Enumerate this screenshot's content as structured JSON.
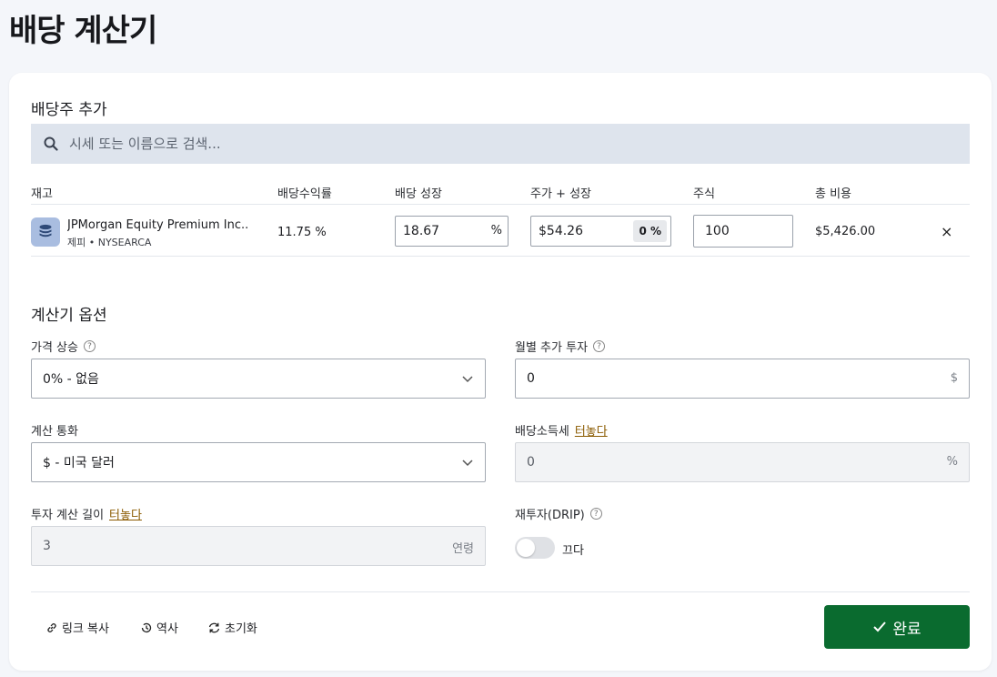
{
  "page": {
    "title": "배당 계산기"
  },
  "add_section": {
    "title": "배당주 추가",
    "search_placeholder": "시세 또는 이름으로 검색..."
  },
  "table": {
    "headers": [
      "재고",
      "배당수익률",
      "배당 성장",
      "주가 + 성장",
      "주식",
      "총 비용"
    ],
    "rows": [
      {
        "name": "JPMorgan Equity Premium Inc...",
        "sub": "제피 • NYSEARCA",
        "yield": "11.75 %",
        "growth": "18.67",
        "growth_unit": "%",
        "price": "$54.26",
        "price_growth": "0 %",
        "shares": "100",
        "total_cost": "$5,426.00",
        "remove_glyph": "×"
      }
    ]
  },
  "options": {
    "title": "계산기 옵션",
    "price_increase": {
      "label": "가격 상승",
      "value": "0% - 없음"
    },
    "monthly_investment": {
      "label": "월별 추가 투자",
      "value": "0",
      "suffix": "$"
    },
    "currency": {
      "label": "계산 통화",
      "value": "$ - 미국 달러"
    },
    "dividend_tax": {
      "label": "배당소득세",
      "unlock": "터놓다",
      "value": "0",
      "suffix": "%"
    },
    "investment_length": {
      "label": "투자 계산 길이",
      "unlock": "터놓다",
      "value": "3",
      "suffix": "연령"
    },
    "drip": {
      "label": "재투자(DRIP)",
      "state_label": "끄다",
      "enabled": false
    }
  },
  "footer": {
    "copy_link": "링크 복사",
    "history": "역사",
    "reset": "초기화",
    "done": "완료"
  },
  "colors": {
    "primary": "#0a6b2f",
    "unlock_link": "#8a5a00",
    "search_bg": "#dee4ed"
  }
}
